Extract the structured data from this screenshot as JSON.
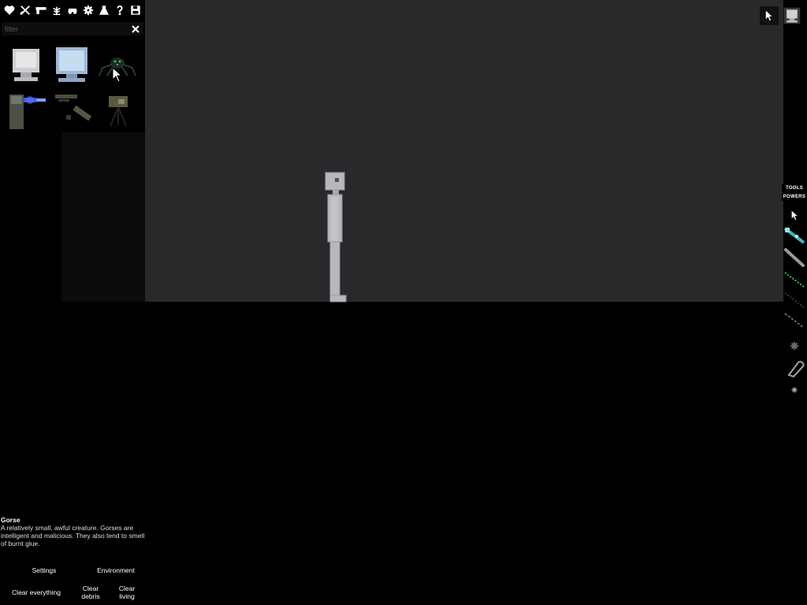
{
  "category_bar": {
    "icons": [
      "heart-icon",
      "crossed-swords-icon",
      "pistol-icon",
      "plant-icon",
      "vehicle-icon",
      "gear-icon",
      "flask-icon",
      "question-icon",
      "save-icon"
    ]
  },
  "filter": {
    "placeholder": "filter",
    "value": ""
  },
  "items": [
    {
      "name": "computer-monitor-item"
    },
    {
      "name": "blue-monitor-item"
    },
    {
      "name": "gorse-creature-item"
    },
    {
      "name": "blue-light-machine-item"
    },
    {
      "name": "rifle-parts-item"
    },
    {
      "name": "tripod-camera-item"
    }
  ],
  "tool_strip": {
    "tabs": {
      "tools": "TOOLS",
      "powers": "POWERS"
    },
    "tools": [
      "pointer-icon",
      "cyan-wire-icon",
      "rod-icon",
      "green-wire-icon",
      "dark-wire-icon",
      "spring-icon",
      "gear-small-icon",
      "hook-icon",
      "spark-icon"
    ]
  },
  "description": {
    "title": "Gorse",
    "body": "A relatively small, awful creature. Gorses are intelligent and malicious. They also tend to smell of burnt glue."
  },
  "bottom": {
    "settings": "Settings",
    "environment": "Environment",
    "clear_everything": "Clear everything",
    "clear_debris": "Clear debris",
    "clear_living": "Clear living"
  },
  "colors": {
    "scene": "#29292c",
    "background": "#000000",
    "ragdoll": "#b8b8bc",
    "wire_cyan": "#3fb7c4",
    "wire_green": "#3ec95a",
    "light_blue": "#3b5bff"
  }
}
